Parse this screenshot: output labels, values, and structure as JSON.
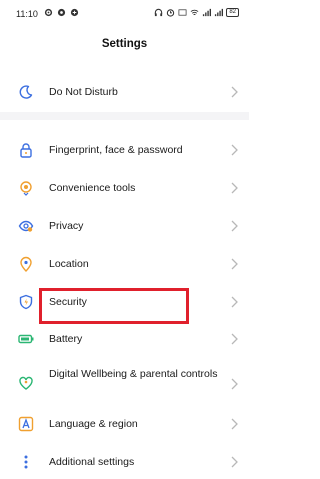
{
  "status_bar": {
    "time": "11:10",
    "battery": "82"
  },
  "header": {
    "title": "Settings"
  },
  "items": [
    {
      "label": "Do Not Disturb",
      "icon": "moon-icon"
    },
    {
      "label": "Fingerprint, face & password",
      "icon": "lock-icon"
    },
    {
      "label": "Convenience tools",
      "icon": "convenience-icon"
    },
    {
      "label": "Privacy",
      "icon": "eye-icon"
    },
    {
      "label": "Location",
      "icon": "location-pin-icon"
    },
    {
      "label": "Security",
      "icon": "shield-icon"
    },
    {
      "label": "Battery",
      "icon": "battery-icon"
    },
    {
      "label": "Digital Wellbeing & parental controls",
      "icon": "heart-person-icon"
    },
    {
      "label": "Language & region",
      "icon": "language-icon"
    },
    {
      "label": "Additional settings",
      "icon": "dots-icon"
    }
  ],
  "colors": {
    "accent_icon": "#3c6fe0",
    "orange_icon": "#f0a030",
    "green_icon": "#2bb673",
    "highlight": "#e0202c",
    "chevron": "#b8b8b8"
  }
}
